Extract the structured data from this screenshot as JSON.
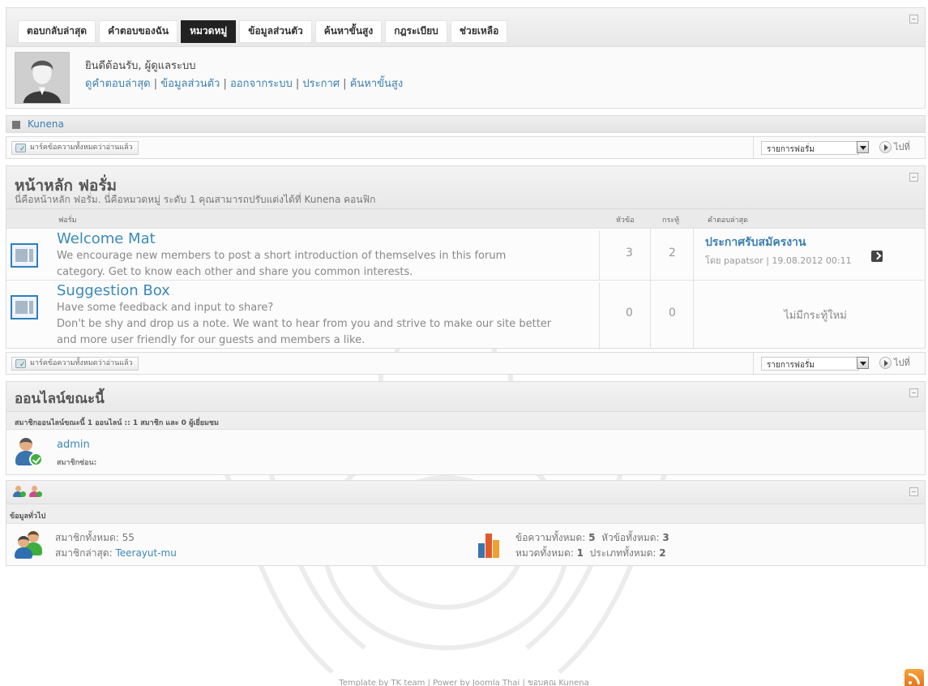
{
  "nav": {
    "tabs": [
      "ตอบกลับล่าสุด",
      "คำตอบของฉัน",
      "หมวดหมู่",
      "ข้อมูลส่วนตัว",
      "ค้นหาขั้นสูง",
      "กฎระเบียบ",
      "ช่วยเหลือ"
    ],
    "active_tab": "หมวดหมู่"
  },
  "profile": {
    "welcome": "ยินดีต้อนรับ, ผู้ดูแลระบบ",
    "links": [
      "ดูคำตอบล่าสุด",
      "ข้อมูลส่วนตัว",
      "ออกจากระบบ",
      "ประกาศ",
      "ค้นหาขั้นสูง"
    ]
  },
  "breadcrumb": {
    "label": "Kunena"
  },
  "markbar": {
    "mark_read_label": "มาร์คข้อความทั้งหมดว่าอ่านแล้ว",
    "forum_select_value": "รายการฟอรั่ม",
    "go_label": "ไปที่"
  },
  "forum_section": {
    "title": "หน้าหลัก ฟอรั่ม",
    "description": "นี่คือหน้าหลัก ฟอรั่ม. นี่คือหมวดหมู่ ระดับ 1 คุณสามารถปรับแต่งได้ที่ Kunena คอนฟิก",
    "columns": {
      "forum": "ฟอรั่ม",
      "topics": "หัวข้อ",
      "replies": "กระทู้",
      "last_post": "คำตอบล่าสุด"
    },
    "forums": [
      {
        "title": "Welcome Mat",
        "description_lines": [
          "We encourage new members to post a short introduction of themselves in this forum",
          "category. Get to know each other and share you common interests."
        ],
        "topics": "3",
        "replies": "2",
        "last_post_title": "ประกาศรับสมัครงาน",
        "last_post_meta": "โดย papatsor | 19.08.2012 00:11"
      },
      {
        "title": "Suggestion Box",
        "description_lines": [
          "Have some feedback and input to share?",
          "Don't be shy and drop us a note. We want to hear from you and strive to make our site better",
          "and more user friendly for our guests and members a like."
        ],
        "topics": "0",
        "replies": "0",
        "no_new_posts": "ไม่มีกระทู้ใหม่"
      }
    ]
  },
  "online": {
    "title": "ออนไลน์ขณะนี้",
    "summary": "สมาชิกออนไลน์ขณะนี้ 1 ออนไลน์ :: 1 สมาชิก และ 0 ผู้เยี่ยมชม",
    "user": "admin",
    "hidden_label": "สมาชิกซ่อน:"
  },
  "stats": {
    "label": "ข้อมูลทั่วไป",
    "total_members": "สมาชิกทั้งหมด: 55",
    "latest_member_label": "สมาชิกล่าสุด:",
    "latest_member": "Teerayut-mu",
    "messages_prefix": "ข้อความทั้งหมด:",
    "messages": "5",
    "topics_prefix": "หัวข้อทั้งหมด:",
    "topics": "3",
    "categories_prefix": "หมวดทั้งหมด:",
    "categories": "1",
    "sections_prefix": "ประเภททั้งหมด:",
    "sections": "2"
  },
  "footer": {
    "text": "Template by TK team | Power by Joomla Thai | ขอบคุณ Kunena"
  },
  "colors": {
    "accent": "#3b7fb0",
    "active_tab": "#222222",
    "online_check": "#3fae3f",
    "rss": "#f08a24"
  },
  "icons": [
    "collapse-icon",
    "category-icon",
    "mark-read-icon",
    "select-arrow-icon",
    "go-icon",
    "forum-icon",
    "last-post-go-icon",
    "online-user-icon",
    "add-user-icon",
    "user-stats-icon",
    "members-icon",
    "stats-chart-icon",
    "rss-icon"
  ]
}
